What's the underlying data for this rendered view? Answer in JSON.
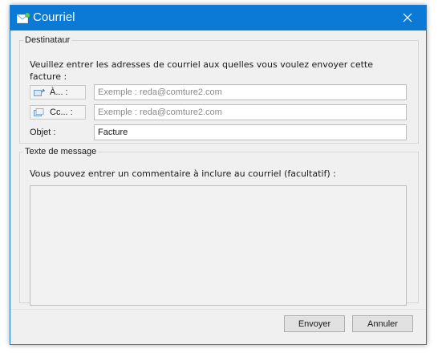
{
  "window": {
    "title": "Courriel",
    "accent_color": "#0a7ad6",
    "title_icon": "email-icon",
    "close_icon": "close-icon"
  },
  "recipient": {
    "legend": "Destinataur",
    "instructions": "Veuillez entrer les adresses de courriel aux quelles vous voulez envoyer cette facture :",
    "to": {
      "label": "À... :",
      "icon": "address-book-to-icon",
      "placeholder": "Exemple : reda@comture2.com",
      "value": ""
    },
    "cc": {
      "label": "Cc... :",
      "icon": "address-book-cc-icon",
      "placeholder": "Exemple : reda@comture2.com",
      "value": ""
    },
    "subject": {
      "label": "Objet :",
      "value": "Facture"
    }
  },
  "message": {
    "legend": "Texte de message",
    "instructions": "Vous pouvez entrer un commentaire à inclure au courriel (facultatif) :",
    "value": ""
  },
  "buttons": {
    "send": "Envoyer",
    "cancel": "Annuler"
  }
}
